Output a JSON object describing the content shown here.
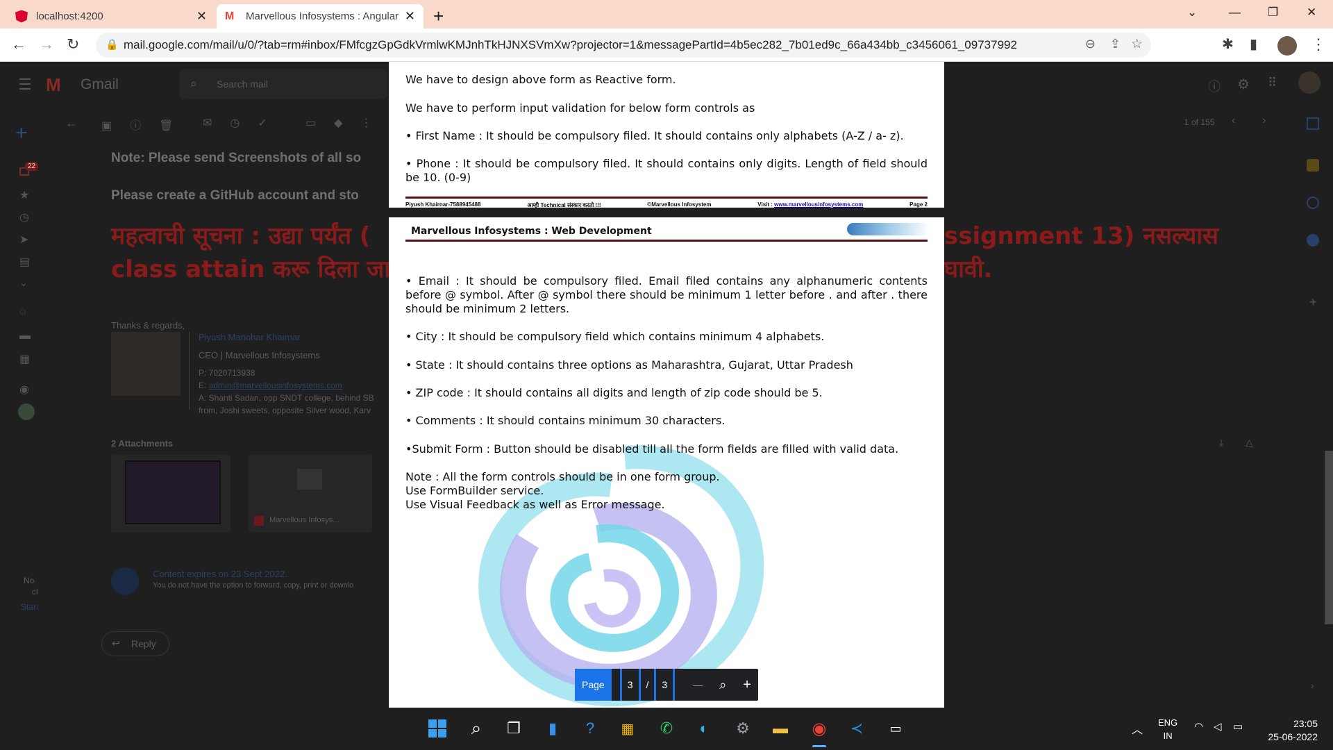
{
  "browser": {
    "tabs": [
      {
        "title": "localhost:4200",
        "icon": "angular-icon"
      },
      {
        "title": "Marvellous Infosystems : Angular",
        "icon": "gmail-icon"
      }
    ],
    "url": "mail.google.com/mail/u/0/?tab=rm#inbox/FMfcgzGpGdkVrmlwKMJnhTkHJNXSVmXw?projector=1&messagePartId=4b5ec282_7b01ed9c_66a434bb_c3456061_09737992"
  },
  "gmail": {
    "logo_text": "Gmail",
    "search_placeholder": "Search mail",
    "pager": "1 of 155",
    "unread_badge": "22",
    "note_line": "Note: Please send Screenshots of all so",
    "github_line": "Please create a GitHub account and sto",
    "marathi_line1_left": "महत्वाची सूचना : उद्या पर्यंत (",
    "marathi_line1_right": "ssignment 13) नसल्यास",
    "marathi_line2_left": "class attain करू दिला जा",
    "marathi_line2_right": "घावी.",
    "regards": "Thanks & regards,",
    "sig_name": "Piyush Manohar Khairnar",
    "sig_title": "CEO | Marvellous Infosystems",
    "sig_phone": "P:  7020713938",
    "sig_email_prefix": "E:",
    "sig_email": "admin@marvellousinfosystems.com",
    "sig_addr1": "A:  Shanti Sadan, opp SNDT college, behind SB",
    "sig_addr2": "from, Joshi sweets, opposite Silver wood, Karv",
    "attachments_header": "2 Attachments",
    "attachment_name": "Marvellous Infosys...",
    "expires": "Content expires on 23 Sept 2022.",
    "expires_sub": "You do not have the option to forward, copy, print or downlo",
    "reply": "Reply",
    "side_note1": "No",
    "side_note2": "cl",
    "side_note3": "Stan"
  },
  "viewer": {
    "page2_lines": [
      "We have to design above form as Reactive form.",
      "We have to perform input validation for below form controls as",
      "• First Name : It should be compulsory filed. It should contains only alphabets (A-Z / a- z).",
      "• Phone : It should be compulsory filed. It should contains only digits. Length of field should be 10. (0-9)"
    ],
    "footer": {
      "author": "Piyush Khairnar-7588945488",
      "marathi": "आम्ही Technical संस्कार करतो !!!",
      "copyright": "©Marvellous Infosystem",
      "visit": "Visit :",
      "site": "www.marvellousinfosystems.com",
      "page": "Page 2"
    },
    "page3_header": "Marvellous Infosystems : Web Development",
    "page3_lines": [
      "• Email : It should be compulsory filed. Email filed contains any alphanumeric contents before @ symbol. After @ symbol there should be minimum 1 letter before . and after . there should be minimum 2 letters.",
      "• City : It should be compulsory field which contains minimum 4 alphabets.",
      "• State : It should contains three options as Maharashtra, Gujarat, Uttar Pradesh",
      "• ZIP code : It should contains all digits and length of zip code should be 5.",
      "• Comments : It should contains minimum 30 characters.",
      "•Submit Form : Button should be disabled till all the form fields are filled with valid data."
    ],
    "note_lines": [
      "Note : All the form controls should be in one form group.",
      "Use FormBuilder service.",
      "Use Visual Feedback as well as Error message."
    ],
    "zoom": {
      "page_label": "Page",
      "current": "3",
      "sep": "/",
      "total": "3",
      "minus": "—",
      "plus": "+"
    }
  },
  "taskbar": {
    "lang1": "ENG",
    "lang2": "IN",
    "time": "23:05",
    "date": "25-06-2022"
  }
}
